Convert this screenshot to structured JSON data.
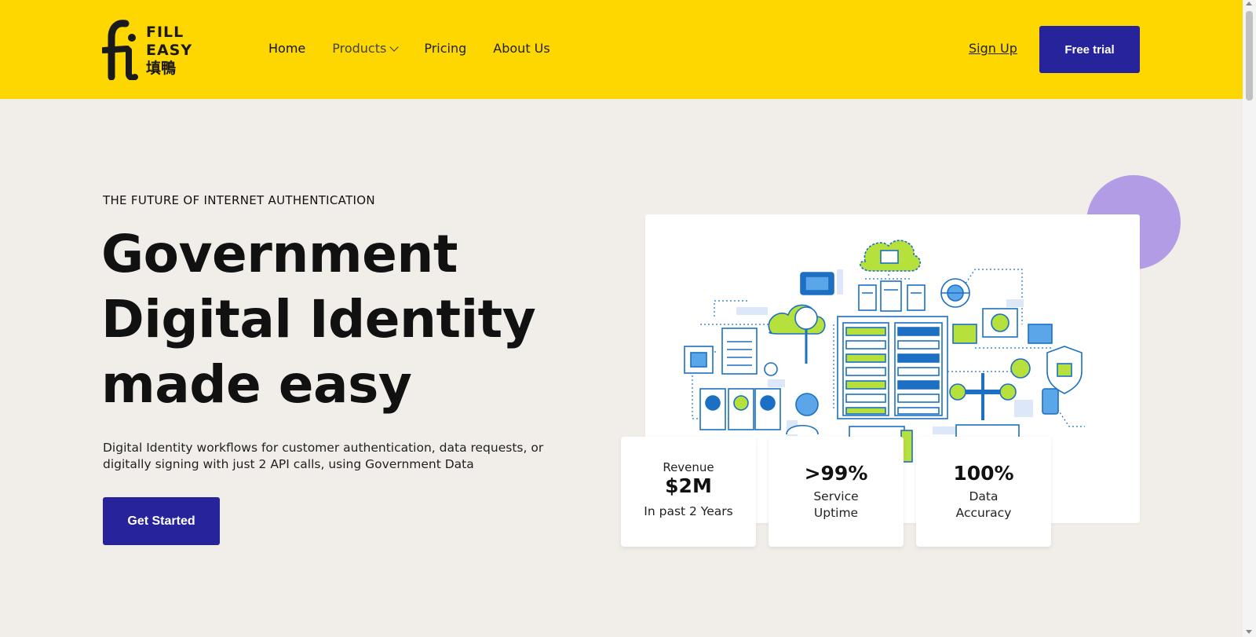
{
  "brand": {
    "name_line1": "FILL",
    "name_line2": "EASY",
    "name_cjk": "填鴨"
  },
  "nav": {
    "items": [
      {
        "label": "Home"
      },
      {
        "label": "Products"
      },
      {
        "label": "Pricing"
      },
      {
        "label": "About Us"
      }
    ],
    "sign_up": "Sign Up",
    "free_trial": "Free trial"
  },
  "hero": {
    "eyebrow": "THE FUTURE OF INTERNET AUTHENTICATION",
    "headline": [
      "Government",
      "Digital Identity",
      "made easy"
    ],
    "description": "Digital Identity workflows for customer authentication, data requests, or digitally signing with just 2 API calls, using Government Data",
    "cta": "Get Started"
  },
  "stats": [
    {
      "top": "Revenue",
      "value": "$2M",
      "bottom": "In past 2 Years"
    },
    {
      "top": "",
      "value": ">99%",
      "bottom": "Service Uptime"
    },
    {
      "top": "",
      "value": "100%",
      "bottom": "Data Accuracy"
    }
  ],
  "colors": {
    "header_bg": "#fed700",
    "page_bg": "#f1ede8",
    "button": "#27239a",
    "accent_circle": "#b39ce6",
    "illus_blue": "#1c6fc3",
    "illus_green": "#b6e03c"
  }
}
